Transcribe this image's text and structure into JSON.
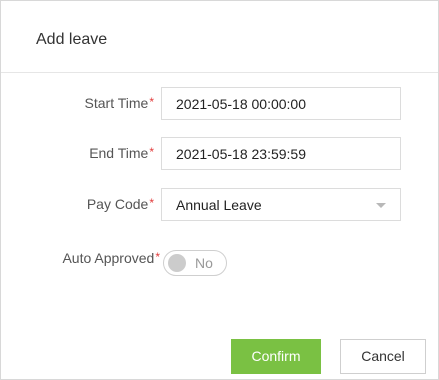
{
  "dialog": {
    "title": "Add leave"
  },
  "form": {
    "start_time": {
      "label": "Start Time",
      "required_mark": "*",
      "value": "2021-05-18 00:00:00"
    },
    "end_time": {
      "label": "End Time",
      "required_mark": "*",
      "value": "2021-05-18 23:59:59"
    },
    "pay_code": {
      "label": "Pay Code",
      "required_mark": "*",
      "value": "Annual Leave"
    },
    "auto_approved": {
      "label": "Auto Approved",
      "required_mark": "*",
      "toggle_text": "No",
      "enabled": false
    }
  },
  "actions": {
    "confirm_label": "Confirm",
    "cancel_label": "Cancel"
  },
  "colors": {
    "accent": "#7ac143",
    "required": "#e23b3b"
  }
}
